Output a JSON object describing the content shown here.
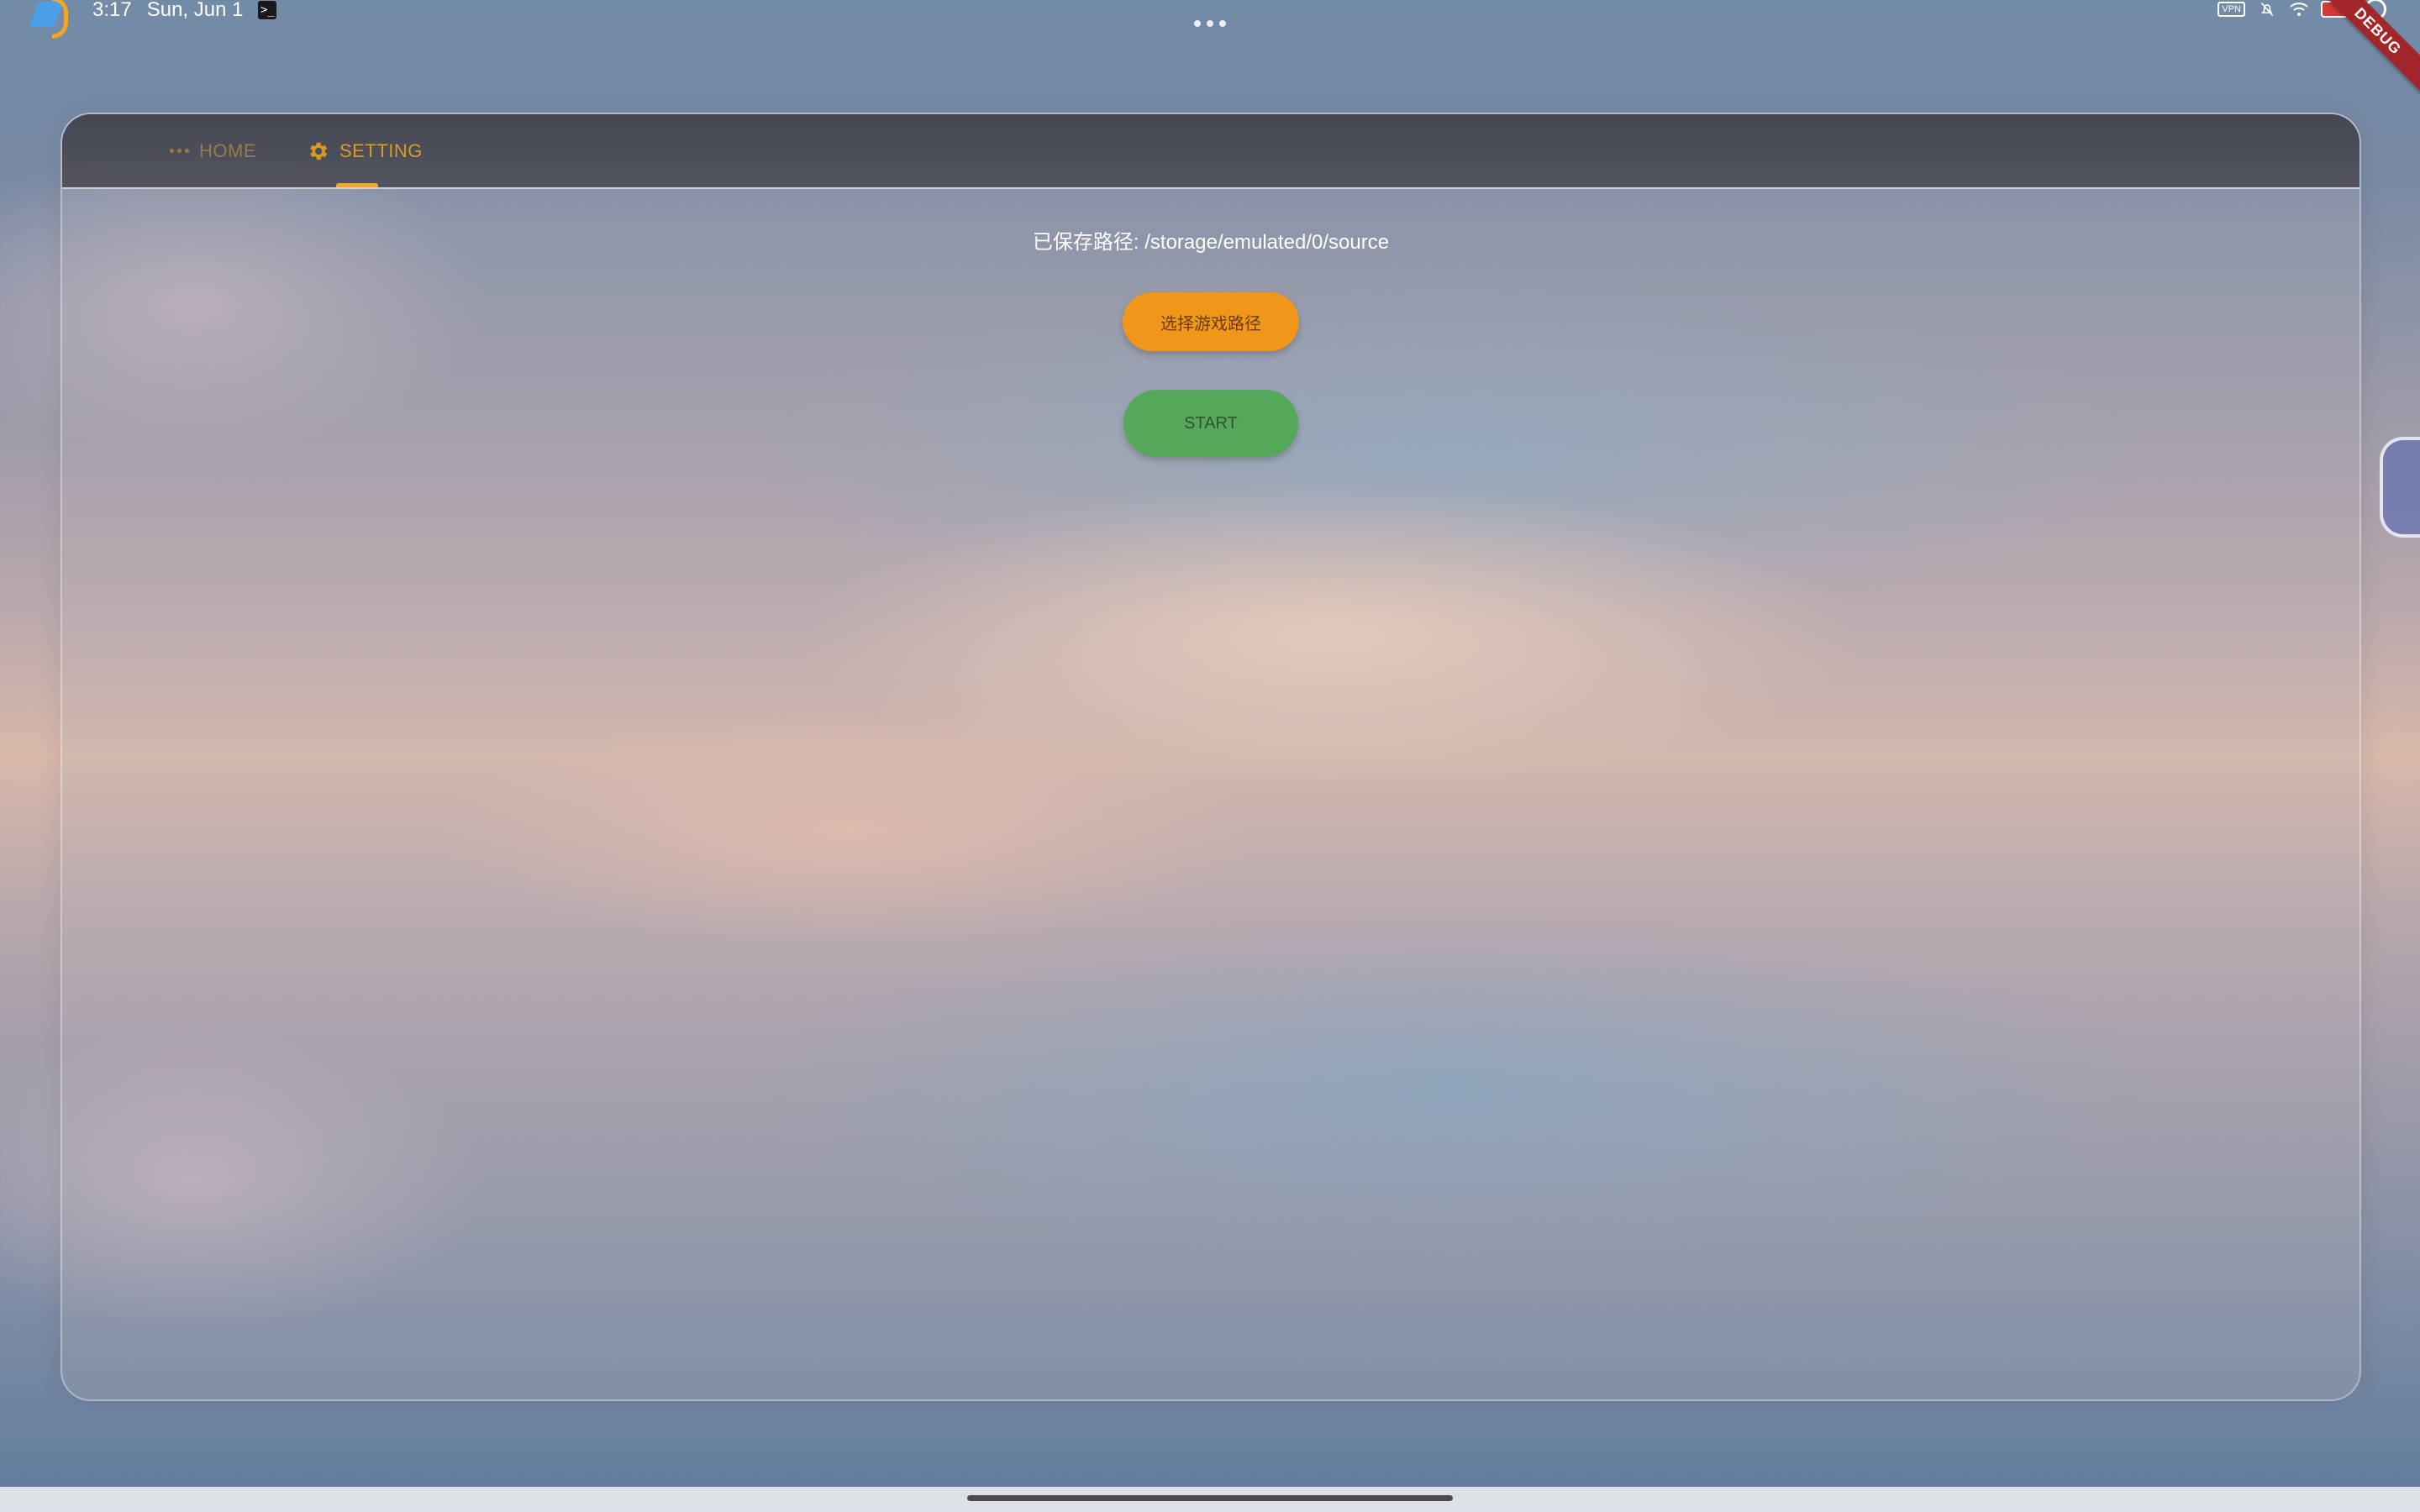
{
  "status_bar": {
    "time": "3:17",
    "date": "Sun, Jun 1",
    "terminal_glyph": ">_",
    "vpn_label": "VPN",
    "debug_label": "DEBUG",
    "icons": [
      "app-logo-icon",
      "terminal-icon",
      "more-icon",
      "vpn-icon",
      "bell-off-icon",
      "wifi-icon",
      "battery-icon",
      "circle-icon"
    ]
  },
  "tabs": [
    {
      "label": "HOME",
      "icon": "more-icon",
      "selected": false
    },
    {
      "label": "SETTING",
      "icon": "gear-icon",
      "selected": true
    }
  ],
  "settings": {
    "saved_path_text": "已保存路径: /storage/emulated/0/source",
    "select_button_label": "选择游戏路径",
    "start_button_label": "START"
  },
  "colors": {
    "accent": "#f2a623",
    "select_button": "#f0971a",
    "start_button": "#55a85a",
    "tab_bar": "#3c3c46",
    "debug_ribbon": "#a3262b"
  }
}
